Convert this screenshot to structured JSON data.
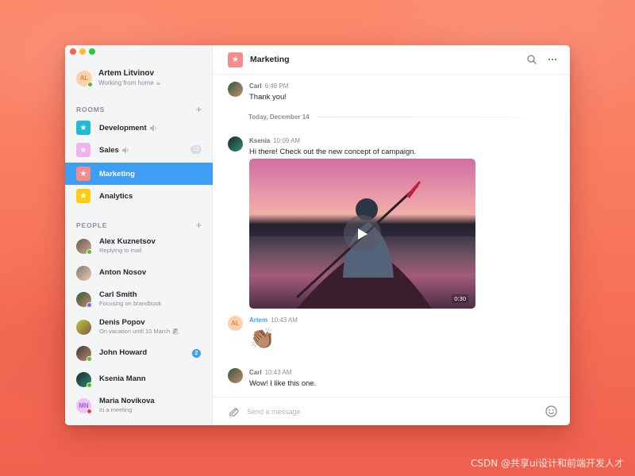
{
  "window": {
    "controls": [
      "close",
      "minimize",
      "maximize"
    ]
  },
  "me": {
    "initials": "AL",
    "name": "Artem Litvinov",
    "status": "Working from home ☕",
    "presence": "online"
  },
  "rooms": {
    "heading": "ROOMS",
    "add_icon": "plus-icon",
    "items": [
      {
        "label": "Development",
        "color": "#1fbad6",
        "muted": true,
        "count": ""
      },
      {
        "label": "Sales",
        "color": "#f0b3f0",
        "muted": true,
        "count": "22"
      },
      {
        "label": "Marketing",
        "color": "#f58b8b",
        "muted": false,
        "count": "",
        "active": true
      },
      {
        "label": "Analytics",
        "color": "#ffcc11",
        "muted": false,
        "count": ""
      }
    ]
  },
  "people": {
    "heading": "PEOPLE",
    "add_icon": "plus-icon",
    "items": [
      {
        "name": "Alex Kuznetsov",
        "status": "Replying to mail",
        "presence": "#52c41a",
        "unread": ""
      },
      {
        "name": "Anton Nosov",
        "status": "",
        "presence": "",
        "unread": ""
      },
      {
        "name": "Carl Smith",
        "status": "Focusing on brandbook",
        "presence": "#8f5bf0",
        "unread": ""
      },
      {
        "name": "Denis Popov",
        "status": "On vacation until 10 March 🏖",
        "presence": "",
        "unread": ""
      },
      {
        "name": "John Howard",
        "status": "",
        "presence": "#52c41a",
        "unread": "2"
      },
      {
        "name": "Ksenia Mann",
        "status": "",
        "presence": "#52c41a",
        "unread": ""
      },
      {
        "name": "Maria Novikova",
        "status": "In a meeting",
        "presence": "#e0443c",
        "unread": "",
        "initials": "MN"
      }
    ]
  },
  "channel": {
    "title": "Marketing",
    "icon": "star-icon",
    "actions": [
      "search-icon",
      "more-icon"
    ]
  },
  "messages": [
    {
      "author": "Carl",
      "time": "6:49 PM",
      "text": "Thank you!"
    },
    {
      "author": "Ksenia",
      "time": "10:09 AM",
      "text": "Hi there! Check out the new concept of campaign."
    },
    {
      "author": "Artem",
      "time": "10:43 AM",
      "text": "👏🏽",
      "initials": "AL"
    },
    {
      "author": "Carl",
      "time": "10:43 AM",
      "text": "Wow! I like this one."
    }
  ],
  "date_separator": "Today, December 14",
  "video": {
    "duration": "0:30",
    "play_icon": "play-icon"
  },
  "composer": {
    "placeholder": "Send a message",
    "value": "",
    "attach_icon": "paperclip-icon",
    "emoji_icon": "smiley-icon"
  },
  "watermark": "CSDN @共享ui设计和前端开发人才"
}
